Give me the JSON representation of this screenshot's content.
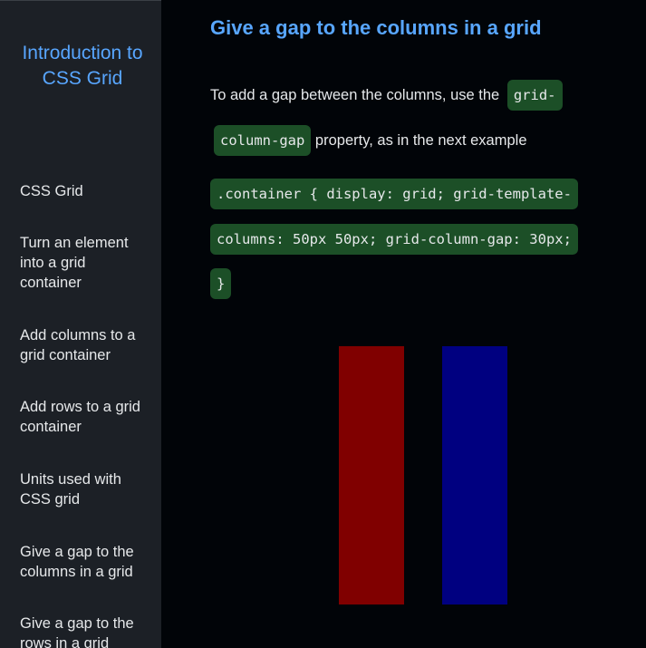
{
  "sidebar": {
    "title": "Introduction to CSS Grid",
    "items": [
      {
        "label": "CSS Grid"
      },
      {
        "label": "Turn an element into a grid container"
      },
      {
        "label": "Add columns to a grid container"
      },
      {
        "label": "Add rows to a grid container"
      },
      {
        "label": "Units used with CSS grid"
      },
      {
        "label": "Give a gap to the columns in a grid"
      },
      {
        "label": "Give a gap to the rows in a grid"
      }
    ]
  },
  "main": {
    "heading": "Give a gap to the columns in a grid",
    "intro_before": "To add a gap between the columns, use the",
    "intro_code": "grid-column-gap",
    "intro_after": "property, as in the next example",
    "code_example": ".container { display: grid; grid-template-columns: 50px 50px; grid-column-gap: 30px; }",
    "demo": {
      "columns": [
        {
          "color": "#800000"
        },
        {
          "color": "#000080"
        }
      ]
    }
  }
}
